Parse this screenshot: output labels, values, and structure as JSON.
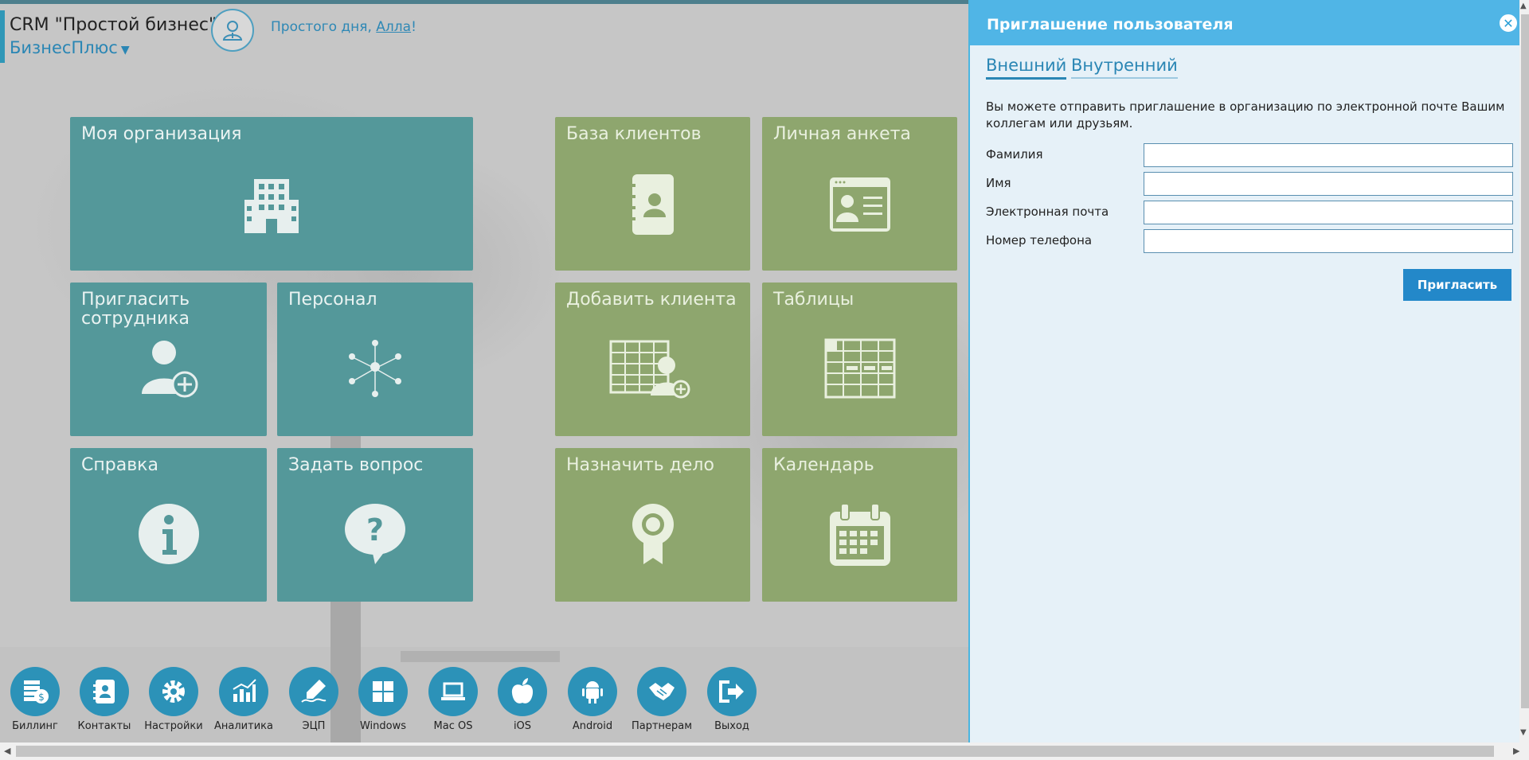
{
  "header": {
    "app_title": "CRM \"Простой бизнес\"",
    "org_name": "БизнесПлюс",
    "greeting_prefix": "Просто",
    "greeting_mid": "го дня, ",
    "greeting_user": "Алла",
    "greeting_suffix": "!"
  },
  "tiles": {
    "my_org": "Моя организация",
    "invite": "Пригласить сотрудника",
    "staff": "Персонал",
    "help": "Справка",
    "ask": "Задать вопрос",
    "clients": "База клиентов",
    "profile": "Личная анкета",
    "add_client": "Добавить клиента",
    "tables": "Таблицы",
    "assign": "Назначить дело",
    "calendar": "Календарь"
  },
  "dock": {
    "billing": "Биллинг",
    "contacts": "Контакты",
    "settings": "Настройки",
    "analytics": "Аналитика",
    "ecp": "ЭЦП",
    "windows": "Windows",
    "macos": "Mac OS",
    "ios": "iOS",
    "android": "Android",
    "partners": "Партнерам",
    "exit": "Выход"
  },
  "invite_panel": {
    "title": "Приглашение пользователя",
    "tab_external": "Внешний",
    "tab_internal": "Внутренний",
    "intro": "Вы можете отправить приглашение в организацию по электронной почте Вашим коллегам или друзьям.",
    "label_lastname": "Фамилия",
    "label_firstname": "Имя",
    "label_email": "Электронная почта",
    "label_phone": "Номер телефона",
    "value_lastname": "",
    "value_firstname": "",
    "value_email": "",
    "value_phone": "",
    "invite_button": "Пригласить"
  },
  "colors": {
    "teal_tile": "#54989a",
    "green_tile": "#8ea66e",
    "dock_button": "#2c92b8",
    "panel_header": "#50b5e6",
    "primary_button": "#2388c9"
  }
}
